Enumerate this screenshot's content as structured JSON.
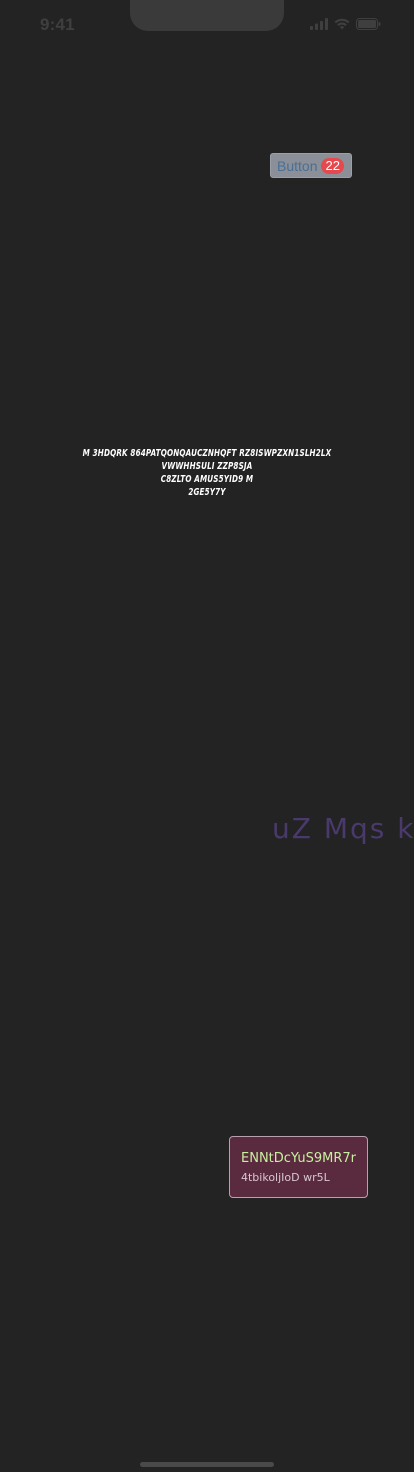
{
  "status_bar": {
    "time": "9:41",
    "icons": [
      "signal-icon",
      "wifi-icon",
      "battery-icon"
    ]
  },
  "badge_button": {
    "label": "Button",
    "count": "22"
  },
  "condensed_text": {
    "lines": [
      "M 3HDQRK 864PATQONQAUCZNHQFT RZ8ISWPZXN1SLH2LX VWWHHSULI ZZP8SJA",
      "C8ZLTO AMUS5YID9 M",
      "2GE5Y7Y"
    ]
  },
  "purple_text": "uZ Mqs k",
  "card": {
    "title": "ENNtDcYuS9MR7r",
    "subtitle": "4tbikoljIoD wr5L"
  },
  "colors": {
    "background": "#232323",
    "button_bg": "#8a8f98",
    "badge": "#e5484d",
    "purple_text": "#4a3a6c",
    "card_bg": "#5a2a3e",
    "card_title": "#c8f0a0"
  }
}
